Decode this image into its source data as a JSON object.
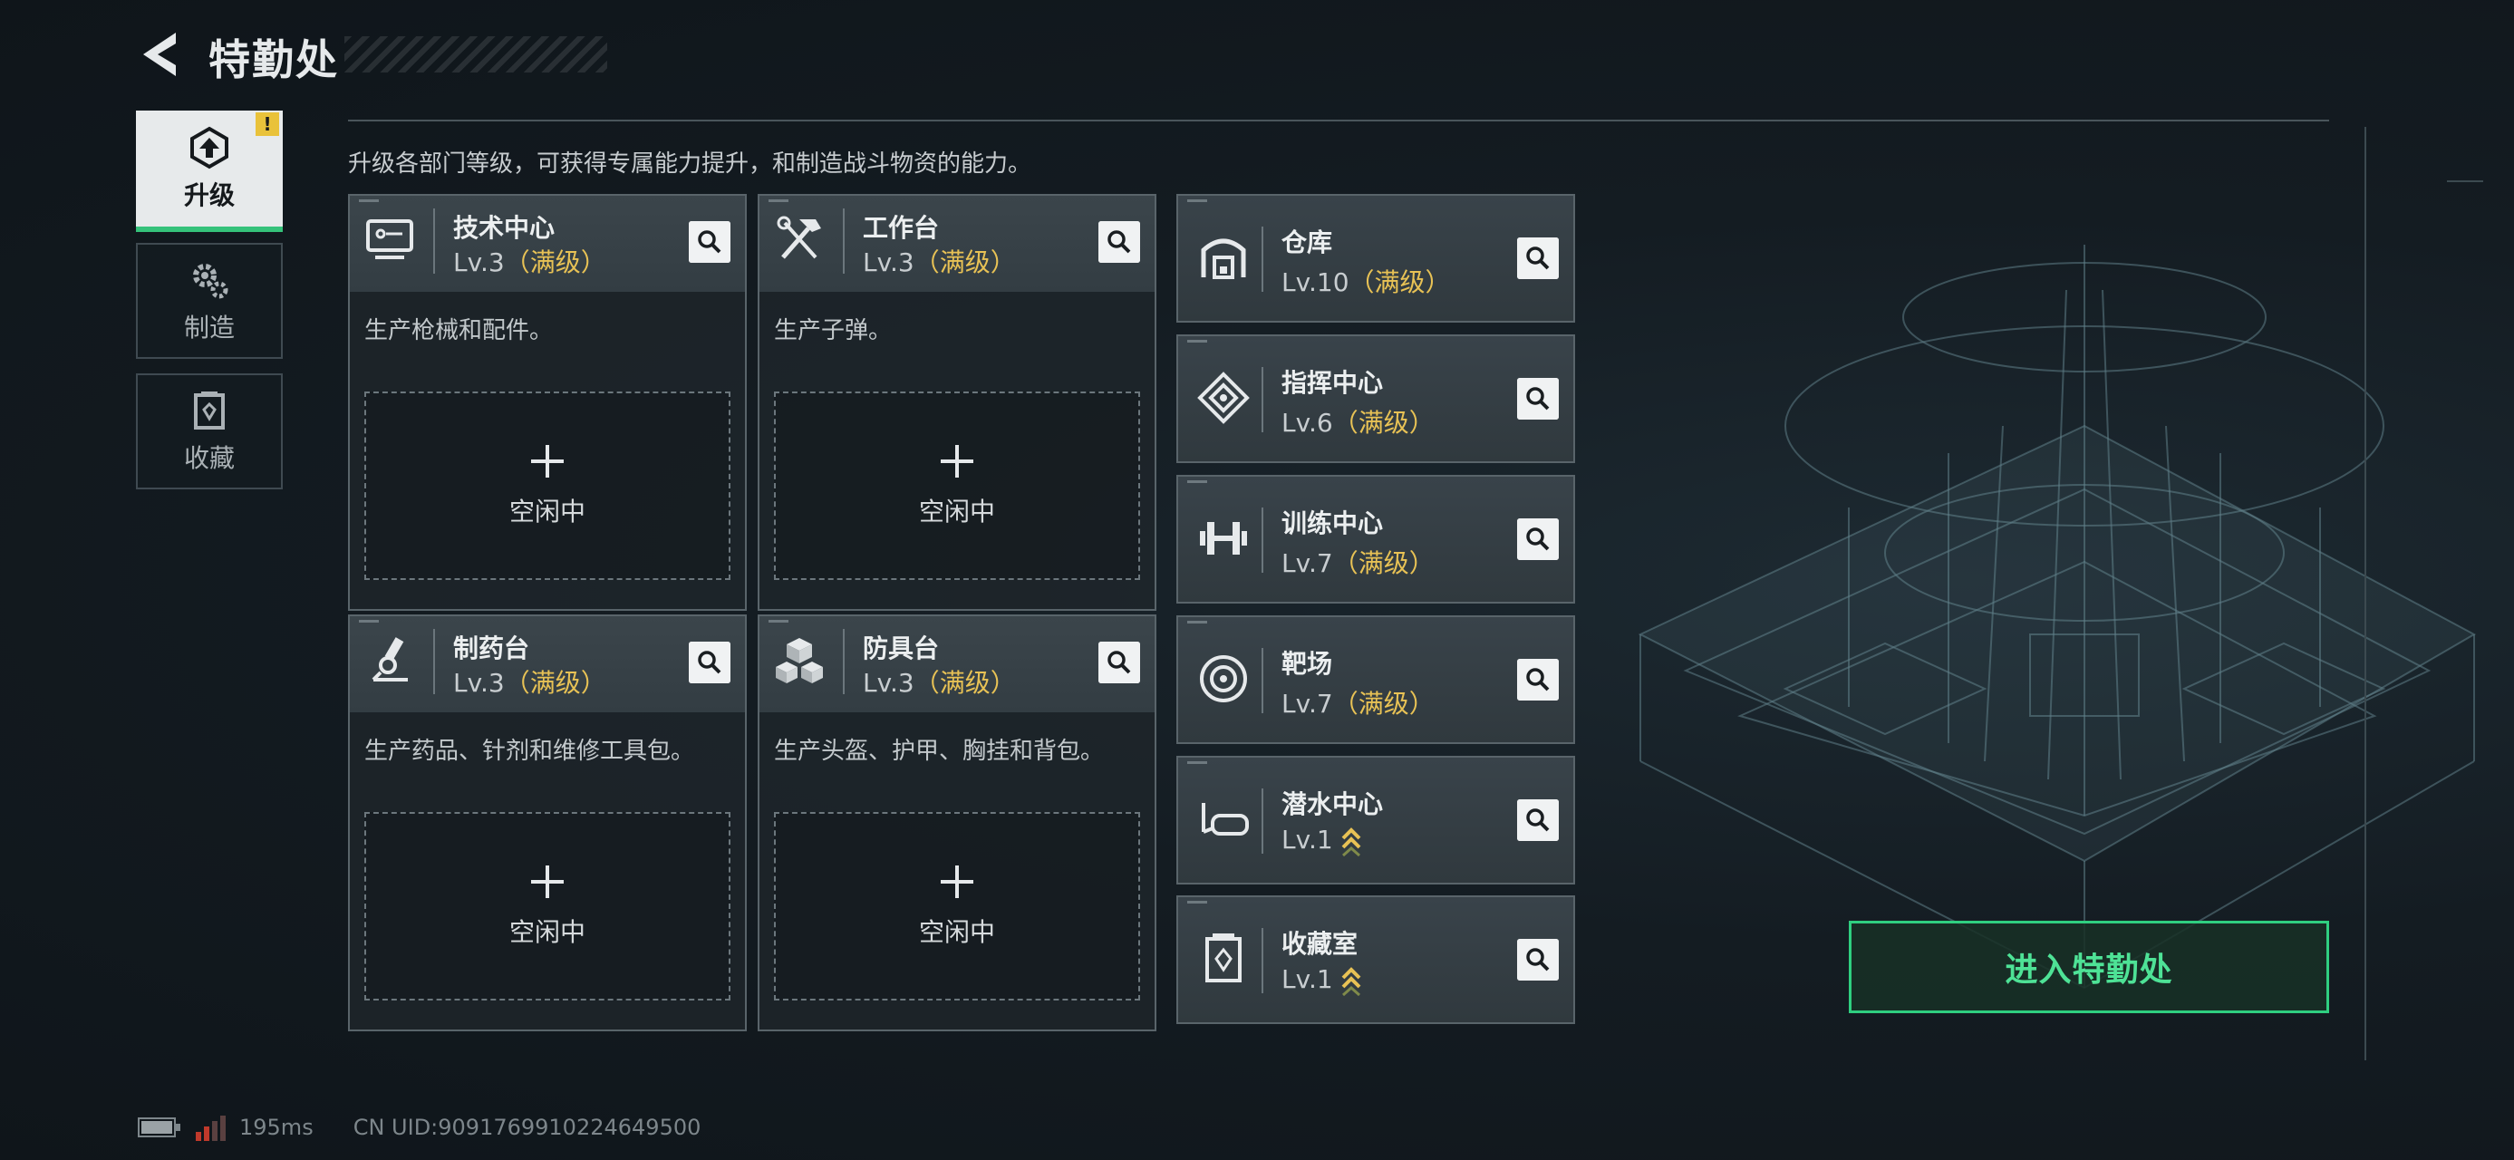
{
  "header": {
    "title": "特勤处"
  },
  "tabs": [
    {
      "label": "升级",
      "active": true,
      "badge": "!"
    },
    {
      "label": "制造",
      "active": false
    },
    {
      "label": "收藏",
      "active": false
    }
  ],
  "description": "升级各部门等级，可获得专属能力提升，和制造战斗物资的能力。",
  "big_cards": [
    {
      "name": "技术中心",
      "level": "Lv.3",
      "status": "（满级）",
      "desc": "生产枪械和配件。",
      "slot_label": "空闲中",
      "icon": "monitor-icon"
    },
    {
      "name": "工作台",
      "level": "Lv.3",
      "status": "（满级）",
      "desc": "生产子弹。",
      "slot_label": "空闲中",
      "icon": "tools-icon"
    },
    {
      "name": "制药台",
      "level": "Lv.3",
      "status": "（满级）",
      "desc": "生产药品、针剂和维修工具包。",
      "slot_label": "空闲中",
      "icon": "microscope-icon"
    },
    {
      "name": "防具台",
      "level": "Lv.3",
      "status": "（满级）",
      "desc": "生产头盔、护甲、胸挂和背包。",
      "slot_label": "空闲中",
      "icon": "boxes-icon"
    }
  ],
  "small_cards": [
    {
      "name": "仓库",
      "level": "Lv.10",
      "status": "（满级）",
      "icon": "warehouse-icon",
      "upgradable": false
    },
    {
      "name": "指挥中心",
      "level": "Lv.6",
      "status": "（满级）",
      "icon": "command-icon",
      "upgradable": false
    },
    {
      "name": "训练中心",
      "level": "Lv.7",
      "status": "（满级）",
      "icon": "dumbbell-icon",
      "upgradable": false
    },
    {
      "name": "靶场",
      "level": "Lv.7",
      "status": "（满级）",
      "icon": "target-icon",
      "upgradable": false
    },
    {
      "name": "潜水中心",
      "level": "Lv.1",
      "status": "",
      "icon": "diving-mask-icon",
      "upgradable": true
    },
    {
      "name": "收藏室",
      "level": "Lv.1",
      "status": "",
      "icon": "collection-icon",
      "upgradable": true
    }
  ],
  "enter_button": "进入特勤处",
  "status_bar": {
    "ping": "195ms",
    "uid": "CN UID:9091769910224649500"
  },
  "colors": {
    "accent_green": "#2fcf80",
    "maxed_yellow": "#e8c255",
    "badge_yellow": "#e9c23a"
  }
}
